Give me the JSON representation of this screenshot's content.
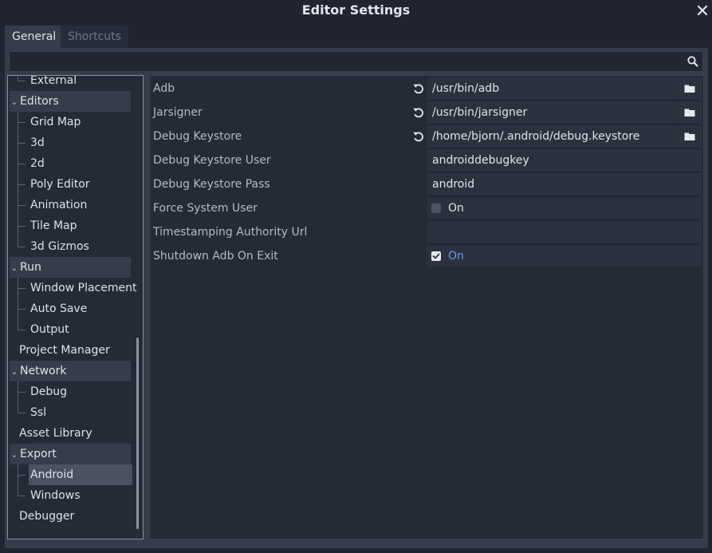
{
  "window": {
    "title": "Editor Settings"
  },
  "tabs": [
    {
      "label": "General"
    },
    {
      "label": "Shortcuts"
    }
  ],
  "search": {
    "placeholder": "",
    "value": ""
  },
  "tree": {
    "external": "External",
    "editors": "Editors",
    "grid_map": "Grid Map",
    "d3": "3d",
    "d2": "2d",
    "poly_editor": "Poly Editor",
    "animation": "Animation",
    "tile_map": "Tile Map",
    "gizmos_3d": "3d Gizmos",
    "run": "Run",
    "window_placement": "Window Placement",
    "auto_save": "Auto Save",
    "output": "Output",
    "project_manager": "Project Manager",
    "network": "Network",
    "debug": "Debug",
    "ssl": "Ssl",
    "asset_library": "Asset Library",
    "export": "Export",
    "android": "Android",
    "windows": "Windows",
    "debugger": "Debugger"
  },
  "properties": {
    "adb": {
      "label": "Adb",
      "value": "/usr/bin/adb"
    },
    "jarsigner": {
      "label": "Jarsigner",
      "value": "/usr/bin/jarsigner"
    },
    "debug_keystore": {
      "label": "Debug Keystore",
      "value": "/home/bjorn/.android/debug.keystore"
    },
    "debug_keystore_user": {
      "label": "Debug Keystore User",
      "value": "androiddebugkey"
    },
    "debug_keystore_pass": {
      "label": "Debug Keystore Pass",
      "value": "android"
    },
    "force_system_user": {
      "label": "Force System User",
      "value": "On",
      "checked": false
    },
    "timestamping_authority_url": {
      "label": "Timestamping Authority Url",
      "value": ""
    },
    "shutdown_adb_on_exit": {
      "label": "Shutdown Adb On Exit",
      "value": "On",
      "checked": true
    }
  },
  "colors": {
    "background": "#202531",
    "panel": "#363d4a",
    "tree_background": "#242a36",
    "selected_item": "#4a5160",
    "accent": "#699ce8"
  },
  "icons": {
    "close": "close-icon",
    "search": "search-icon",
    "revert": "revert-icon",
    "folder": "folder-icon",
    "collapse": "chevron-down-icon",
    "checkbox": "checkbox-icon"
  }
}
